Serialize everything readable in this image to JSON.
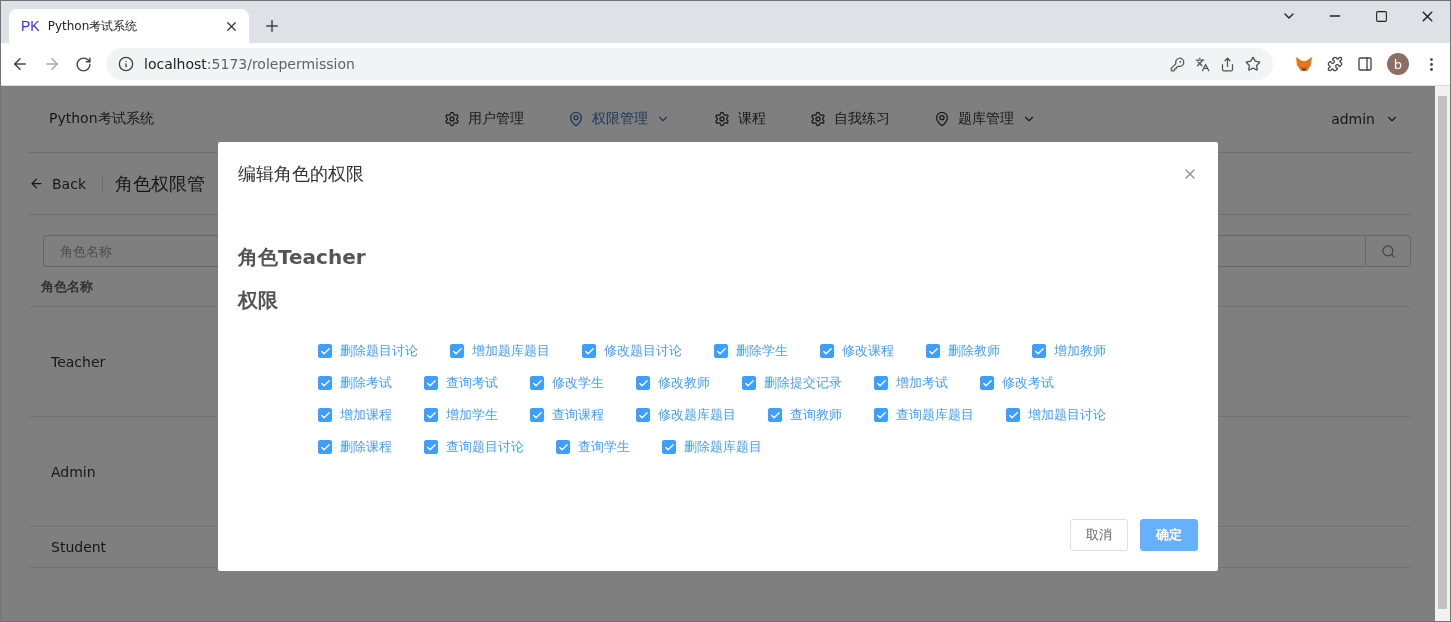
{
  "browser": {
    "tab": {
      "favicon": "PK",
      "title": "Python考试系统"
    },
    "url": {
      "host": "localhost",
      "path": ":5173/rolepermission"
    },
    "profile": "b"
  },
  "header": {
    "brand": "Python考试系统",
    "nav": [
      {
        "label": "用户管理",
        "kind": "gear",
        "selected": false,
        "dropdown": false
      },
      {
        "label": "权限管理",
        "kind": "pin",
        "selected": true,
        "dropdown": true
      },
      {
        "label": "课程",
        "kind": "gear",
        "selected": false,
        "dropdown": false
      },
      {
        "label": "自我练习",
        "kind": "gear",
        "selected": false,
        "dropdown": false
      },
      {
        "label": "题库管理",
        "kind": "pin",
        "selected": false,
        "dropdown": true
      }
    ],
    "user": "admin"
  },
  "page": {
    "back": "Back",
    "title": "角色权限管",
    "search": {
      "placeholder": "角色名称"
    },
    "table": {
      "columns": [
        "角色名称"
      ],
      "rows": [
        "Teacher",
        "Admin",
        "Student"
      ]
    }
  },
  "dialog": {
    "title": "编辑角色的权限",
    "role": "角色Teacher",
    "section": "权限",
    "permissions": [
      {
        "label": "删除题目讨论",
        "checked": true
      },
      {
        "label": "增加题库题目",
        "checked": true
      },
      {
        "label": "修改题目讨论",
        "checked": true
      },
      {
        "label": "删除学生",
        "checked": true
      },
      {
        "label": "修改课程",
        "checked": true
      },
      {
        "label": "删除教师",
        "checked": true
      },
      {
        "label": "增加教师",
        "checked": true
      },
      {
        "label": "删除考试",
        "checked": true
      },
      {
        "label": "查询考试",
        "checked": true
      },
      {
        "label": "修改学生",
        "checked": true
      },
      {
        "label": "修改教师",
        "checked": true
      },
      {
        "label": "删除提交记录",
        "checked": true
      },
      {
        "label": "增加考试",
        "checked": true
      },
      {
        "label": "修改考试",
        "checked": true
      },
      {
        "label": "增加课程",
        "checked": true
      },
      {
        "label": "增加学生",
        "checked": true
      },
      {
        "label": "查询课程",
        "checked": true
      },
      {
        "label": "修改题库题目",
        "checked": true
      },
      {
        "label": "查询教师",
        "checked": true
      },
      {
        "label": "查询题库题目",
        "checked": true
      },
      {
        "label": "增加题目讨论",
        "checked": true
      },
      {
        "label": "删除课程",
        "checked": true
      },
      {
        "label": "查询题目讨论",
        "checked": true
      },
      {
        "label": "查询学生",
        "checked": true
      },
      {
        "label": "删除题库题目",
        "checked": true
      }
    ],
    "buttons": [
      {
        "label": "取消",
        "kind": "secondary"
      },
      {
        "label": "确定",
        "kind": "primary"
      }
    ]
  }
}
